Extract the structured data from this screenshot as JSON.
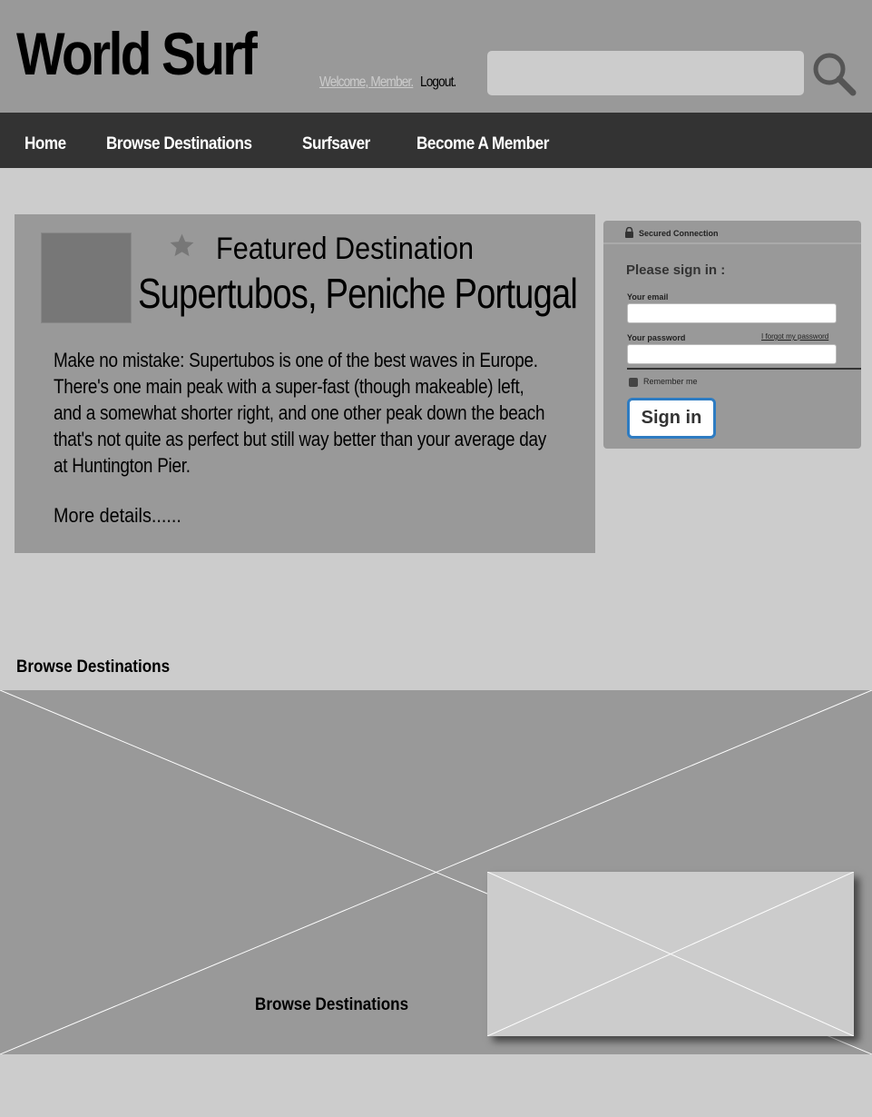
{
  "header": {
    "site_title": "World Surf",
    "welcome_text": "Welcome, Member.",
    "logout_text": "Logout.",
    "search_placeholder": "",
    "search_icon": "magnifier-icon"
  },
  "nav": {
    "items": [
      {
        "label": "Home"
      },
      {
        "label": "Browse Destinations"
      },
      {
        "label": "Surfsaver"
      },
      {
        "label": "Become A Member"
      }
    ]
  },
  "featured": {
    "heading": "Featured Destination",
    "name": "Supertubos, Peniche Portugal",
    "description": "Make no mistake: Supertubos is one of the best waves in Europe. There's one main peak with a super-fast (though makeable) left, and a somewhat shorter right, and one other peak down the beach that's not quite as perfect but still way better than your average day at Huntington Pier.",
    "more_link": "More details......",
    "star_icon": "star-icon"
  },
  "signin": {
    "secured_label": "Secured Connection",
    "title": "Please sign in :",
    "email_label": "Your email",
    "email_value": "",
    "password_label": "Your password",
    "password_value": "",
    "forgot_link": "I forgot my password",
    "remember_label": "Remember me",
    "button_label": "Sign in",
    "button_border_color": "#2e7cc2"
  },
  "browse": {
    "title": "Browse Destinations",
    "caption": "Browse Destinations"
  },
  "colors": {
    "page_bg": "#cccccc",
    "header_bg": "#999999",
    "nav_bg": "#333333",
    "panel_bg": "#999999",
    "placeholder_light": "#cccccc"
  }
}
